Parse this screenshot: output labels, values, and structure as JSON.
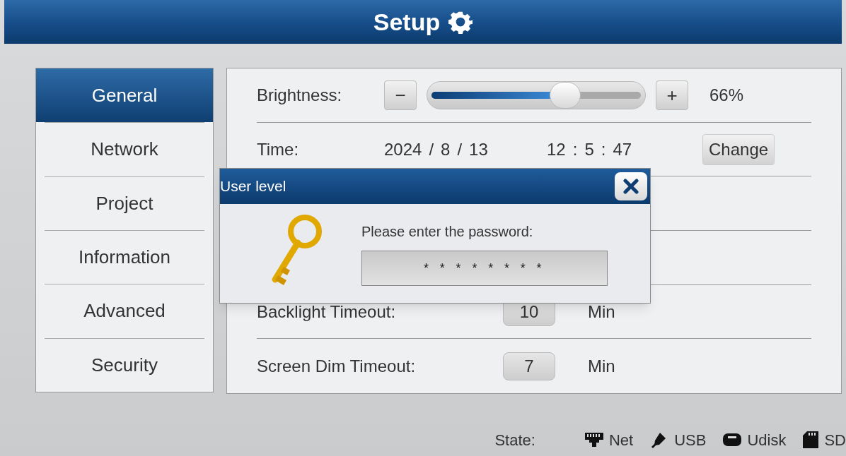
{
  "header": {
    "title": "Setup"
  },
  "sidebar": {
    "items": [
      {
        "label": "General",
        "selected": true
      },
      {
        "label": "Network",
        "selected": false
      },
      {
        "label": "Project",
        "selected": false
      },
      {
        "label": "Information",
        "selected": false
      },
      {
        "label": "Advanced",
        "selected": false
      },
      {
        "label": "Security",
        "selected": false
      }
    ]
  },
  "settings": [
    {
      "kind": "slider",
      "label": "Brightness:",
      "minus": "−",
      "plus": "+",
      "level": 0.64,
      "reading": "66%"
    },
    {
      "kind": "datetime",
      "label": "Time:",
      "date": [
        "2024",
        "/",
        "8",
        "/",
        "13"
      ],
      "time": [
        "12",
        ":",
        "5",
        ":",
        "47"
      ],
      "button": "Change"
    },
    {
      "kind": "number",
      "label": "Backlight Timeout:",
      "value": "10",
      "unit": "Min"
    },
    {
      "kind": "number",
      "label": "Screen Dim Timeout:",
      "value": "7",
      "unit": "Min"
    }
  ],
  "dialog": {
    "title": "User level",
    "prompt": "Please enter the password:",
    "value": "* * * * * * * *"
  },
  "status_bar": {
    "label": "State:",
    "items": [
      {
        "kind": "net",
        "label": "Net"
      },
      {
        "kind": "usb",
        "label": "USB"
      },
      {
        "kind": "udisk",
        "label": "Udisk"
      },
      {
        "kind": "sd",
        "label": "SD"
      }
    ]
  }
}
